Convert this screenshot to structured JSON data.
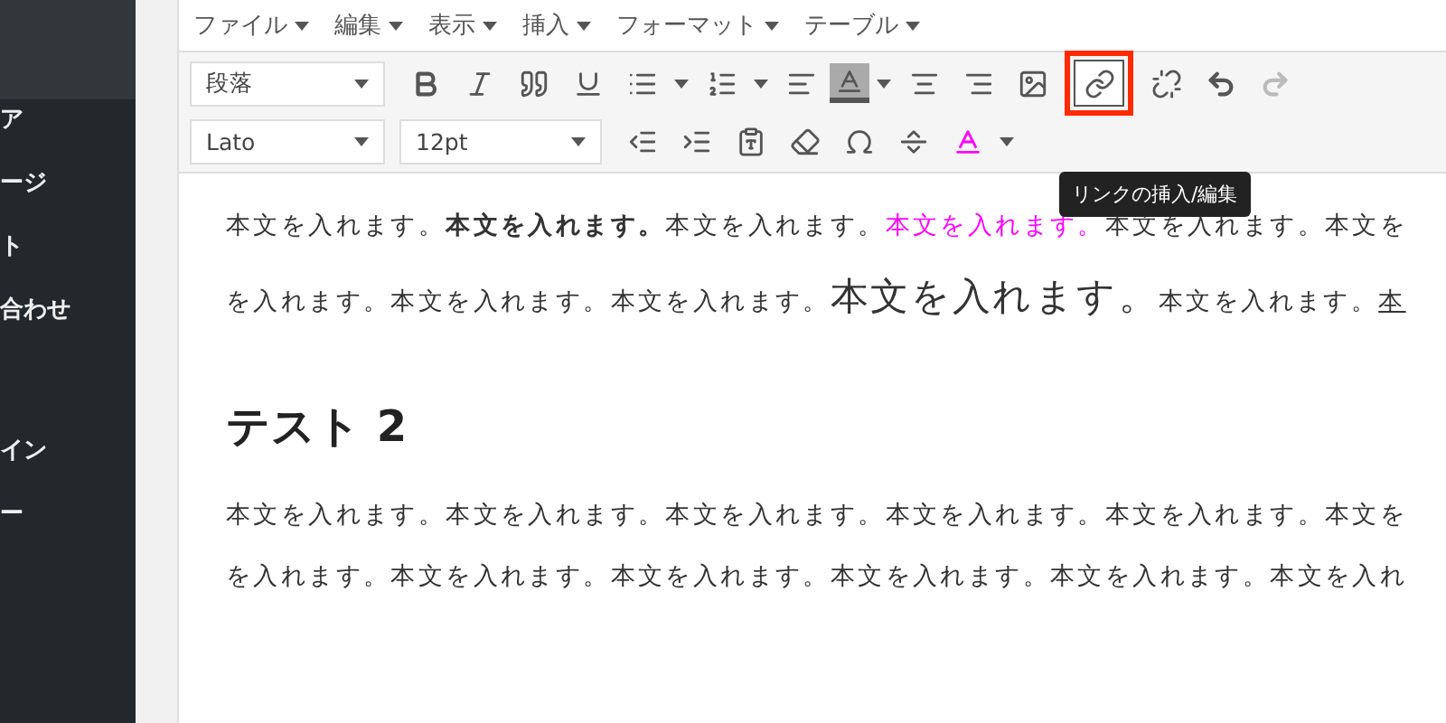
{
  "sidebar": {
    "items": [
      {
        "label": "ア"
      },
      {
        "label": "ージ"
      },
      {
        "label": "ト"
      },
      {
        "label": "合わせ"
      },
      {
        "label": "イン"
      },
      {
        "label": "ー"
      }
    ]
  },
  "menu": [
    "ファイル",
    "編集",
    "表示",
    "挿入",
    "フォーマット",
    "テーブル"
  ],
  "toolbar": {
    "format_select": "段落",
    "font_select": "Lato",
    "size_select": "12pt",
    "link_button": {
      "pressed": true,
      "highlighted": true
    },
    "redo_button": {
      "disabled": true
    },
    "tooltip": "リンクの挿入/編集"
  },
  "content": [
    {
      "kind": "paragraph",
      "lines": [
        [
          {
            "kind": "normal",
            "text": "本文を入れます。"
          },
          {
            "kind": "bold",
            "text": "本文を入れます。"
          },
          {
            "kind": "normal",
            "text": "本文を入れます。"
          },
          {
            "kind": "colored",
            "text": "本文を入れます。",
            "color": "#ff00ff"
          },
          {
            "kind": "normal",
            "text": "本文を入れます。本文を"
          }
        ],
        [
          {
            "kind": "normal",
            "text": "を入れます。本文を入れます。本文を入れます。"
          },
          {
            "kind": "large",
            "text": "本文を入れます。"
          },
          {
            "kind": "normal",
            "text": "本文を入れます。"
          },
          {
            "kind": "underline",
            "text": "本"
          }
        ]
      ]
    },
    {
      "kind": "heading",
      "text": "テスト 2"
    },
    {
      "kind": "paragraph",
      "lines": [
        [
          {
            "kind": "normal",
            "text": "本文を入れます。本文を入れます。本文を入れます。本文を入れます。本文を入れます。本文を"
          }
        ],
        [
          {
            "kind": "normal",
            "text": "を入れます。本文を入れます。本文を入れます。本文を入れます。本文を入れます。本文を入れ"
          }
        ]
      ]
    }
  ]
}
